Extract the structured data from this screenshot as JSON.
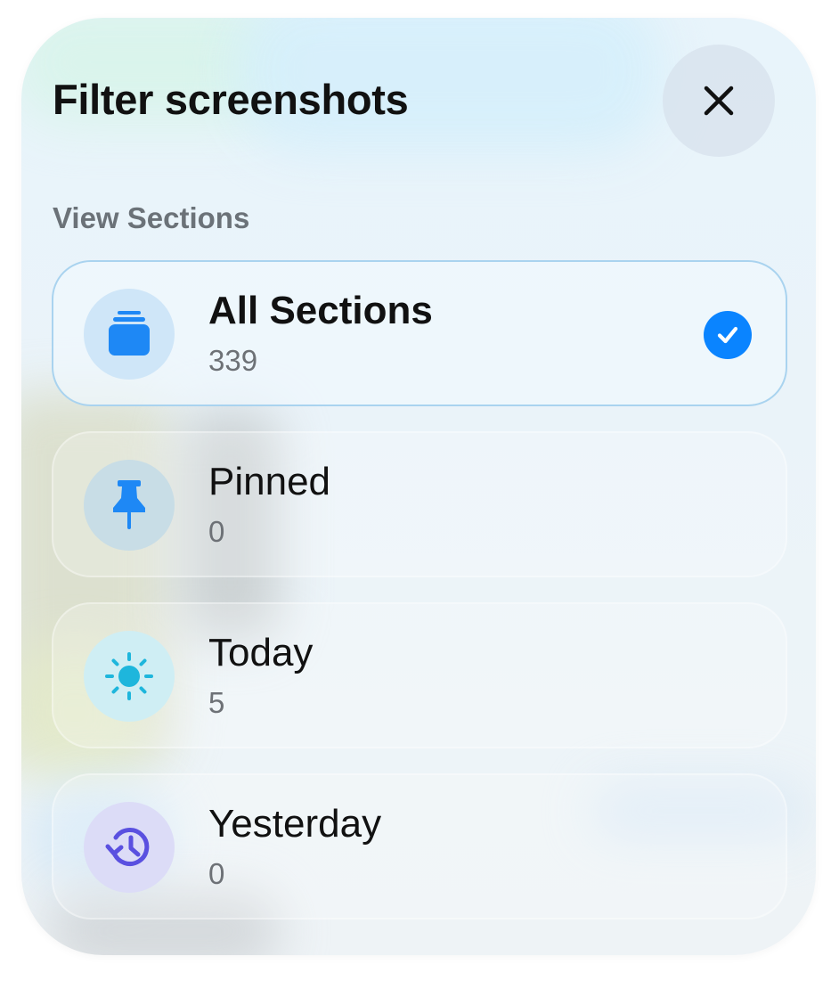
{
  "header": {
    "title": "Filter screenshots",
    "close_icon": "close-icon"
  },
  "section_label": "View Sections",
  "selected_index": 0,
  "colors": {
    "accent": "#0a84ff",
    "selected_border": "#a9d3ef"
  },
  "items": [
    {
      "label": "All Sections",
      "count": "339",
      "icon": "stack-icon",
      "icon_color": "#1e88f5",
      "icon_bg": "#cfe6f8",
      "selected": true
    },
    {
      "label": "Pinned",
      "count": "0",
      "icon": "pin-icon",
      "icon_color": "#1e88f5",
      "icon_bg": "#c8dde6",
      "selected": false
    },
    {
      "label": "Today",
      "count": "5",
      "icon": "sun-icon",
      "icon_color": "#1eb6dc",
      "icon_bg": "#cfeef4",
      "selected": false
    },
    {
      "label": "Yesterday",
      "count": "0",
      "icon": "history-icon",
      "icon_color": "#5a50e0",
      "icon_bg": "#dcdcf7",
      "selected": false
    }
  ]
}
